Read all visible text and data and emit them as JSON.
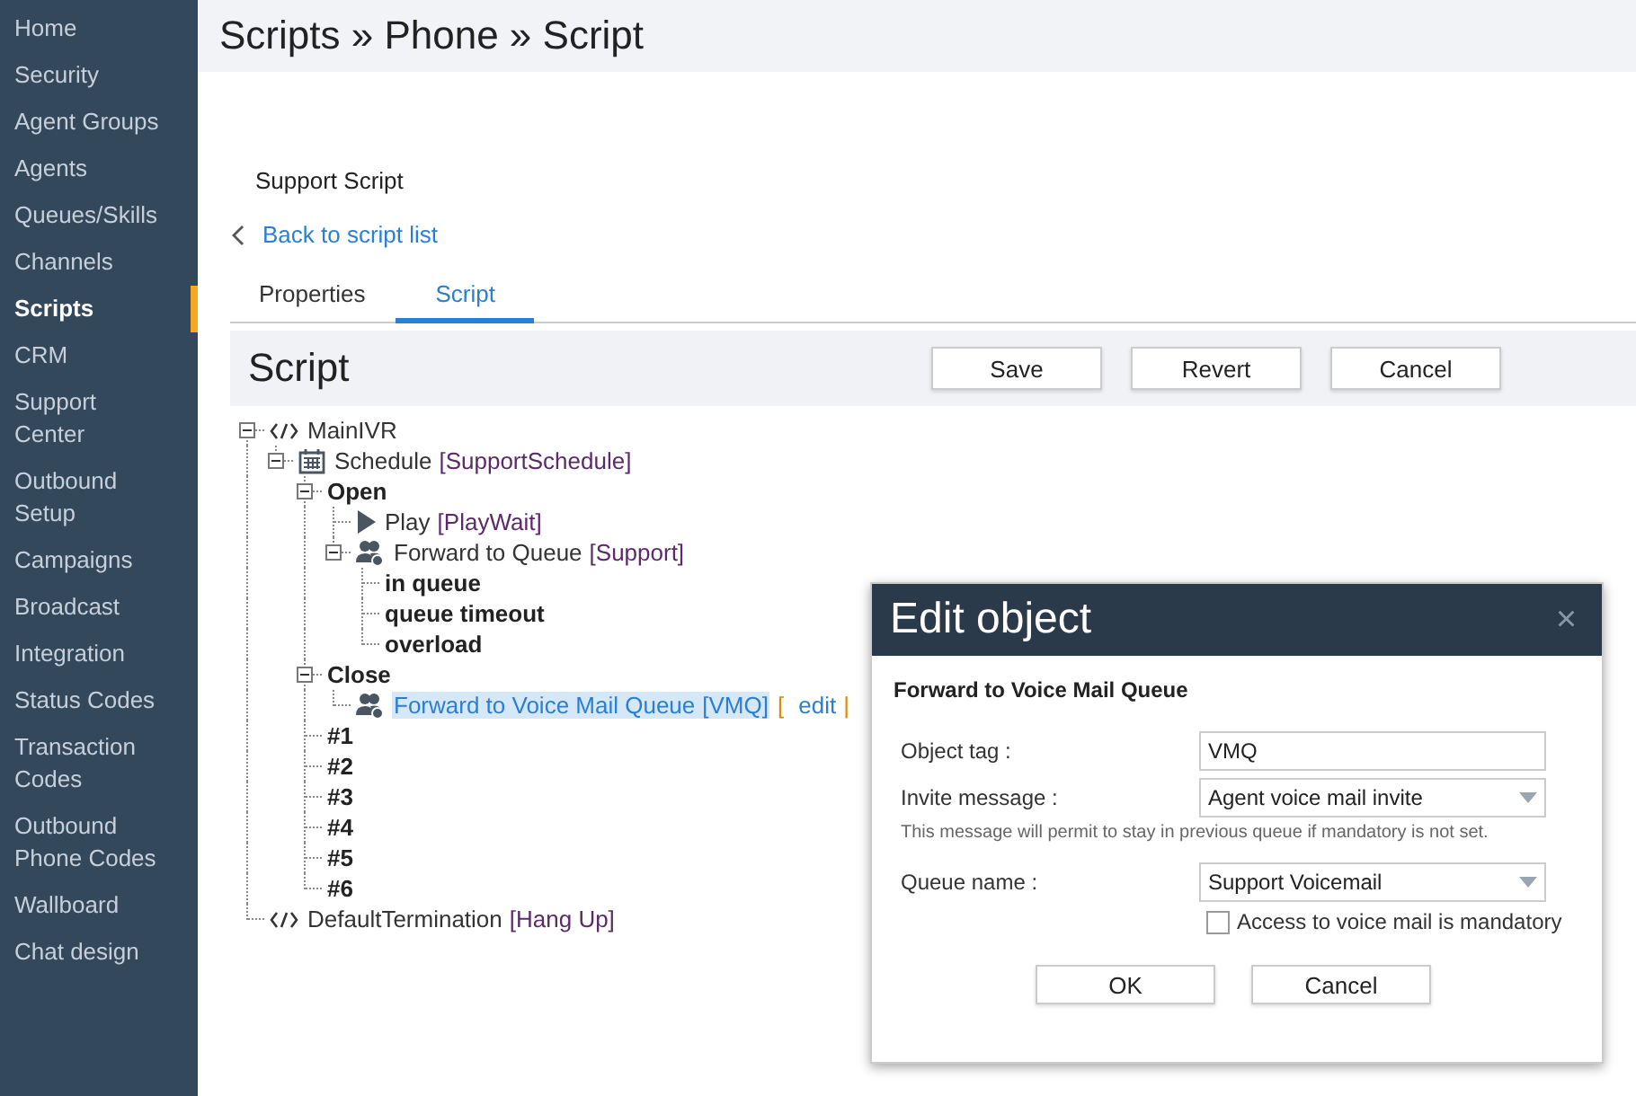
{
  "sidebar": {
    "items": [
      {
        "label": "Home",
        "selected": false
      },
      {
        "label": "Security",
        "selected": false
      },
      {
        "label": "Agent Groups",
        "selected": false
      },
      {
        "label": "Agents",
        "selected": false
      },
      {
        "label": "Queues/Skills",
        "selected": false
      },
      {
        "label": "Channels",
        "selected": false
      },
      {
        "label": "Scripts",
        "selected": true
      },
      {
        "label": "CRM",
        "selected": false
      },
      {
        "label": "Support Center",
        "selected": false
      },
      {
        "label": "Outbound Setup",
        "selected": false
      },
      {
        "label": "Campaigns",
        "selected": false
      },
      {
        "label": "Broadcast",
        "selected": false
      },
      {
        "label": "Integration",
        "selected": false
      },
      {
        "label": "Status Codes",
        "selected": false
      },
      {
        "label": "Transaction Codes",
        "selected": false
      },
      {
        "label": "Outbound Phone Codes",
        "selected": false
      },
      {
        "label": "Wallboard",
        "selected": false
      },
      {
        "label": "Chat design",
        "selected": false
      }
    ]
  },
  "page": {
    "title": "Scripts » Phone » Script",
    "subtitle": "Support Script",
    "back_link": "Back to script list"
  },
  "tabs": [
    {
      "label": "Properties",
      "selected": false
    },
    {
      "label": "Script",
      "selected": true
    }
  ],
  "panel": {
    "title": "Script",
    "buttons": [
      "Save",
      "Revert",
      "Cancel"
    ]
  },
  "tree": {
    "nodes": [
      {
        "kind": "code",
        "name": "MainIVR",
        "expanded": true,
        "children": [
          {
            "kind": "schedule",
            "name": "Schedule",
            "tag": "[SupportSchedule]",
            "expanded": true,
            "children": [
              {
                "kind": "branch",
                "name": "Open",
                "expanded": true,
                "children": [
                  {
                    "kind": "play",
                    "name": "Play",
                    "tag": "[PlayWait]"
                  },
                  {
                    "kind": "queue",
                    "name": "Forward to Queue",
                    "tag": "[Support]",
                    "expanded": true,
                    "children": [
                      {
                        "kind": "branch",
                        "name": "in queue"
                      },
                      {
                        "kind": "branch",
                        "name": "queue timeout"
                      },
                      {
                        "kind": "branch",
                        "name": "overload"
                      }
                    ]
                  }
                ]
              },
              {
                "kind": "branch",
                "name": "Close",
                "expanded": true,
                "children": [
                  {
                    "kind": "queue",
                    "name": "Forward to Voice Mail Queue",
                    "tag": "[VMQ]",
                    "selected": true,
                    "actions": {
                      "open": "[",
                      "link": "edit",
                      "separator": "|"
                    }
                  }
                ]
              },
              {
                "kind": "branch",
                "name": "#1"
              },
              {
                "kind": "branch",
                "name": "#2"
              },
              {
                "kind": "branch",
                "name": "#3"
              },
              {
                "kind": "branch",
                "name": "#4"
              },
              {
                "kind": "branch",
                "name": "#5"
              },
              {
                "kind": "branch",
                "name": "#6"
              }
            ]
          }
        ]
      },
      {
        "kind": "code",
        "name": "DefaultTermination",
        "tag": "[Hang Up]"
      }
    ]
  },
  "dialog": {
    "title": "Edit object",
    "close": "×",
    "subtitle": "Forward to Voice Mail Queue",
    "fields": [
      {
        "kind": "text",
        "label": "Object tag :",
        "value": "VMQ"
      },
      {
        "kind": "select",
        "label": "Invite message :",
        "value": "Agent voice mail invite",
        "hint": "This message will permit to stay in previous queue if mandatory is not set."
      },
      {
        "kind": "select",
        "label": "Queue name :",
        "value": "Support Voicemail"
      }
    ],
    "checkbox": {
      "label": "Access to voice mail is mandatory",
      "checked": false
    },
    "buttons": [
      "OK",
      "Cancel"
    ]
  }
}
